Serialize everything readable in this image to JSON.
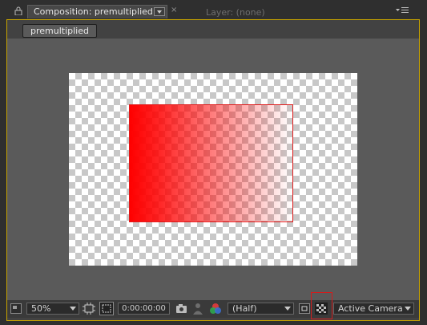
{
  "tabs": {
    "composition_label": "Composition: premultiplied",
    "layer_label": "Layer: (none)",
    "close_glyph": "×"
  },
  "breadcrumb": {
    "label": "premultiplied"
  },
  "toolbar": {
    "zoom": "50%",
    "timecode": "0:00:00:00",
    "resolution": "(Half)",
    "view": "Active Camera"
  },
  "colors": {
    "panel_border": "#c9a400",
    "layer_red": "#ff0000",
    "highlight_box": "#d21d1d"
  },
  "icons": [
    "lock-icon",
    "panel-menu-icon",
    "tab-dropdown-icon",
    "close-icon",
    "always-preview-icon",
    "grid-guides-icon",
    "mask-visibility-icon",
    "snapshot-icon",
    "show-snapshot-icon",
    "color-channels-icon",
    "region-of-interest-icon",
    "transparency-grid-icon",
    "chevron-down-icon"
  ]
}
